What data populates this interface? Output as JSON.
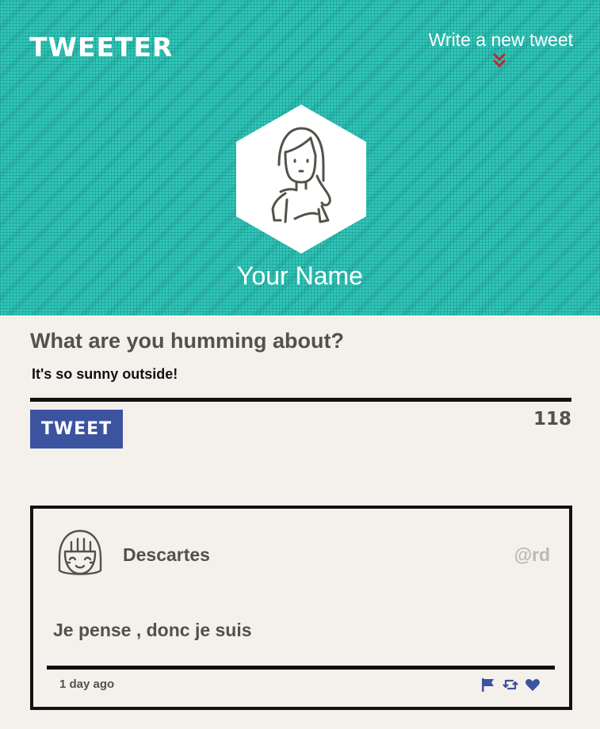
{
  "header": {
    "logo": "TWEETER",
    "write_link": "Write a new tweet",
    "chevron_icon": "double-chevron-down-icon",
    "avatar_icon": "user-avatar-icon",
    "user_name": "Your Name"
  },
  "compose": {
    "title": "What are you humming about?",
    "input_value": "It's so sunny outside!",
    "button_label": "TWEET",
    "counter": "118"
  },
  "tweets": [
    {
      "avatar_icon": "user-avatar-icon",
      "author": "Descartes",
      "handle": "@rd",
      "content": "Je pense , donc je suis",
      "time": "1 day ago",
      "actions": [
        "flag-icon",
        "retweet-icon",
        "heart-icon"
      ]
    }
  ],
  "colors": {
    "header_bg": "#2fc6b8",
    "page_bg": "#f4f1ec",
    "accent": "#3c53a0",
    "chevron": "#c0272d",
    "text": "#545149"
  }
}
